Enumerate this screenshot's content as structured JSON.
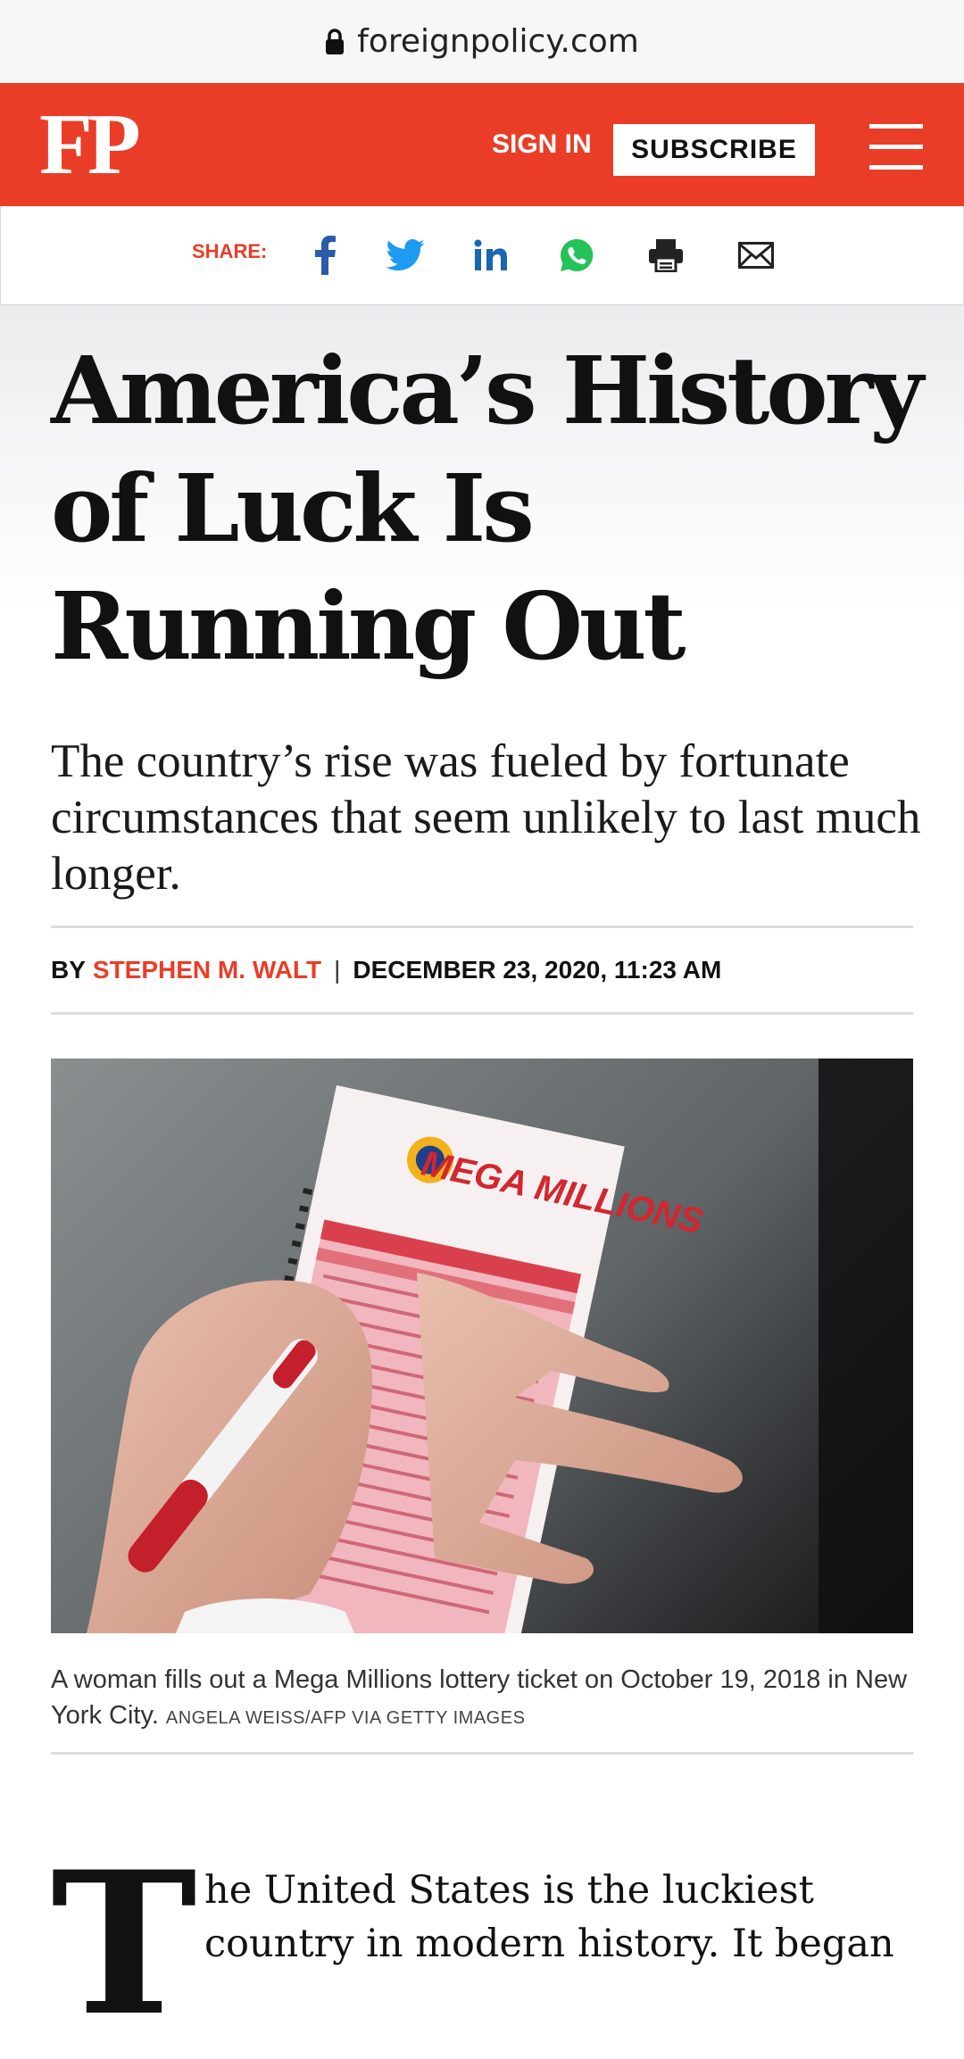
{
  "browser": {
    "url": "foreignpolicy.com",
    "lock_icon": "lock-icon"
  },
  "header": {
    "logo": "FP",
    "sign_in": "SIGN IN",
    "subscribe": "SUBSCRIBE",
    "menu_icon": "hamburger-menu-icon",
    "brand_color": "#ea3d27"
  },
  "share": {
    "label": "SHARE:",
    "icons": [
      "facebook-icon",
      "twitter-icon",
      "linkedin-icon",
      "whatsapp-icon",
      "print-icon",
      "email-icon"
    ]
  },
  "article": {
    "headline": "America’s History of Luck Is Running Out",
    "dek": "The country’s rise was fueled by fortunate circumstances that seem unlikely to last much longer.",
    "byline": {
      "by": "BY",
      "author": "STEPHEN M. WALT",
      "separator": "|",
      "date": "DECEMBER 23, 2020, 11:23 AM"
    },
    "photo": {
      "ticket_brand": "MEGA MILLIONS",
      "caption": "A woman fills out a Mega Millions lottery ticket on October 19, 2018 in New York City.",
      "credit": "ANGELA WEISS/AFP VIA GETTY IMAGES"
    },
    "drop_cap": "T",
    "body_start": "he United States is the luckiest country in modern history. It began"
  }
}
